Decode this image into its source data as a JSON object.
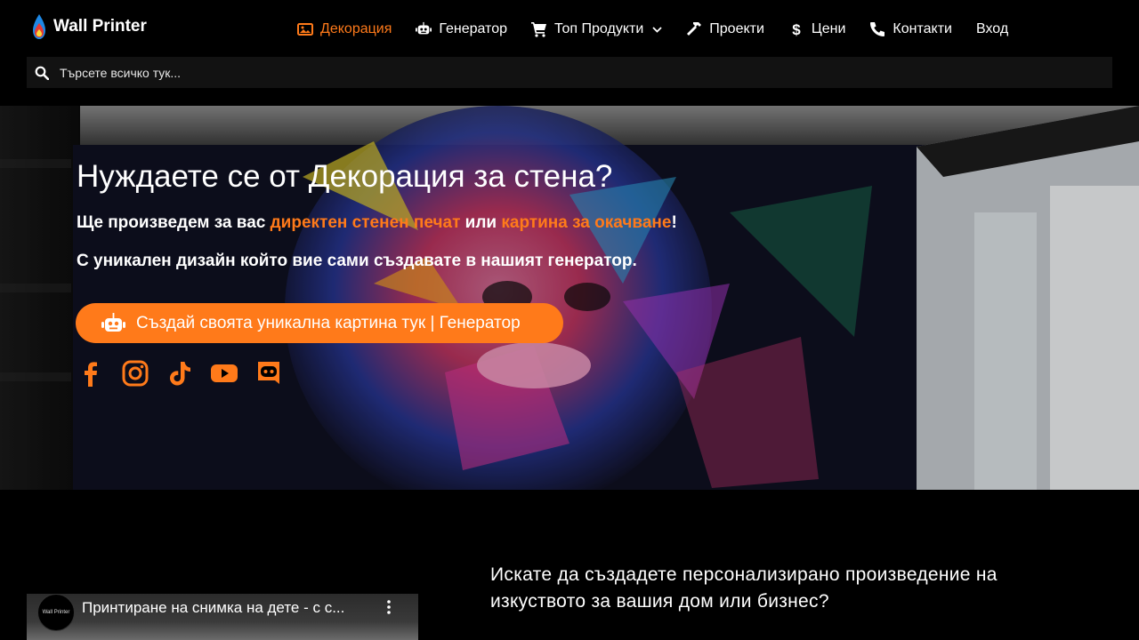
{
  "brand": {
    "name": "Wall Printer"
  },
  "nav": {
    "items": [
      {
        "label": "Декорация",
        "icon": "image-icon",
        "active": true
      },
      {
        "label": "Генератор",
        "icon": "robot-icon"
      },
      {
        "label": "Топ Продукти",
        "icon": "cart-icon",
        "has_dropdown": true
      },
      {
        "label": "Проекти",
        "icon": "hammer-icon"
      },
      {
        "label": "Цени",
        "icon": "dollar-icon"
      },
      {
        "label": "Контакти",
        "icon": "phone-icon"
      }
    ],
    "login": "Вход"
  },
  "search": {
    "placeholder": "Търсете всичко тук..."
  },
  "hero": {
    "title": "Нуждаете се от Декорация за стена?",
    "line1_prefix": "Ще произведем за вас ",
    "line1_link1": "директен стенен печат",
    "line1_middle": " или ",
    "line1_link2": "картина за окачване",
    "line1_suffix": "!",
    "line2": "С уникален дизайн който вие сами създавате в нашият генератор.",
    "cta_label": "Създай своята уникална картина тук | Генератор",
    "socials": [
      "facebook-icon",
      "instagram-icon",
      "tiktok-icon",
      "youtube-icon",
      "discord-icon"
    ]
  },
  "video": {
    "channel_badge": "Wall Printer",
    "title": "Принтиране на снимка на дете - с с..."
  },
  "info": {
    "text": "Искате да създадете персонализирано произведение на изкуството за вашия дом или бизнес?"
  },
  "colors": {
    "accent": "#ff7a1a",
    "background": "#000000",
    "search_bg": "#121212"
  }
}
